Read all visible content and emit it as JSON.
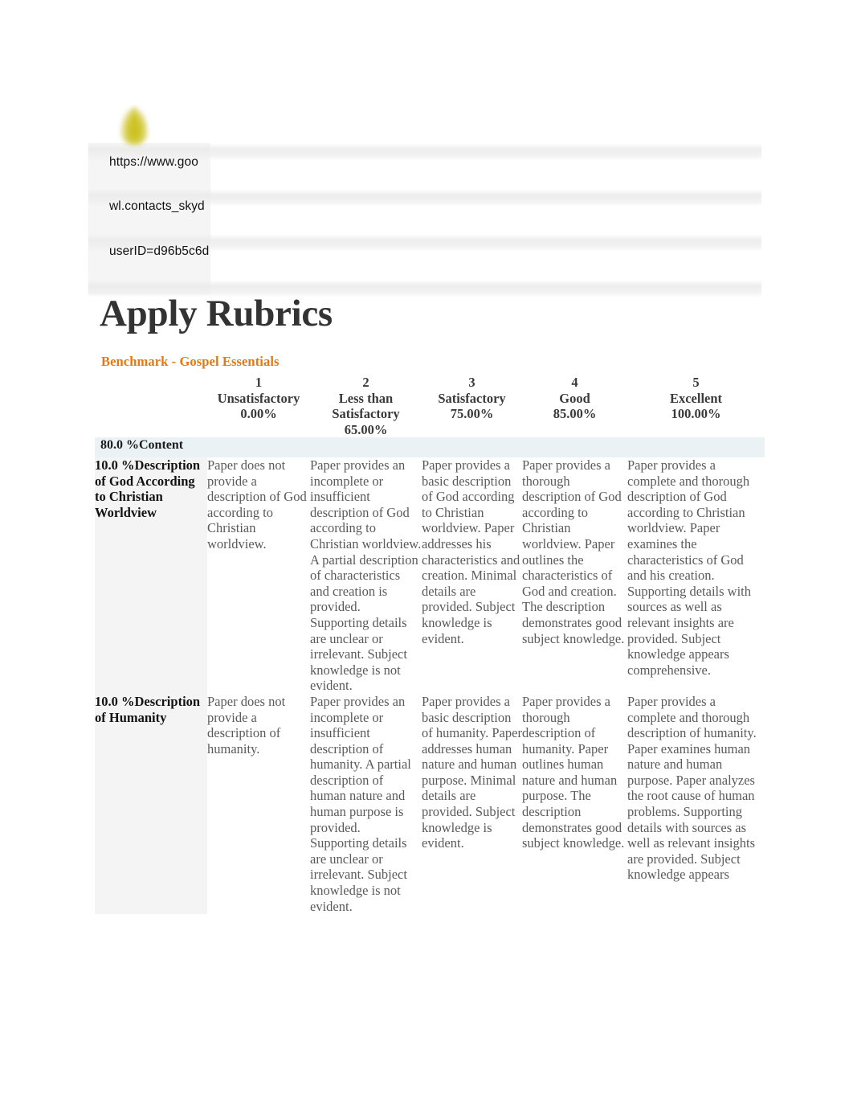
{
  "header": {
    "logo_icon": "flame-logo-icon",
    "lines": [
      "https://www.goo",
      "wl.contacts_skyd",
      "userID=d96b5c6d"
    ]
  },
  "document": {
    "title": "Apply Rubrics",
    "rubric_name": "Benchmark - Gospel Essentials",
    "accent_color": "#e8770c",
    "section_band_color": "#eaf2f5"
  },
  "table": {
    "corner_header": "",
    "columns": [
      {
        "number": "1",
        "label": "Unsatisfactory",
        "percent": "0.00%"
      },
      {
        "number": "2",
        "label": "Less than Satisfactory",
        "percent": "65.00%"
      },
      {
        "number": "3",
        "label": "Satisfactory",
        "percent": "75.00%"
      },
      {
        "number": "4",
        "label": "Good",
        "percent": "85.00%"
      },
      {
        "number": "5",
        "label": "Excellent",
        "percent": "100.00%"
      }
    ],
    "sections": [
      {
        "title": "80.0 %Content",
        "rows": [
          {
            "criterion": "10.0 %Description of God According to Christian Worldview",
            "cells": [
              "Paper does not provide a description of God according to Christian worldview.",
              "Paper provides an incomplete or insufficient description of God according to Christian worldview. A partial description of characteristics and creation is provided. Supporting details are unclear or irrelevant. Subject knowledge is not evident.",
              "Paper provides a basic description of God according to Christian worldview. Paper addresses his characteristics and creation. Minimal details are provided. Subject knowledge is evident.",
              "Paper provides a thorough description of God according to Christian worldview. Paper outlines the characteristics of God and creation. The description demonstrates good subject knowledge.",
              "Paper provides a complete and thorough description of God according to Christian worldview. Paper examines the characteristics of God and his creation. Supporting details with sources as well as relevant insights are provided. Subject knowledge appears comprehensive."
            ]
          },
          {
            "criterion": "10.0 %Description of Humanity",
            "cells": [
              "Paper does not provide a description of humanity.",
              "Paper provides an incomplete or insufficient description of humanity. A partial description of human nature and human purpose is provided. Supporting details are unclear or irrelevant. Subject knowledge is not evident.",
              "Paper provides a basic description of humanity. Paper addresses human nature and human purpose. Minimal details are provided. Subject knowledge is evident.",
              "Paper provides a thorough description of humanity. Paper outlines human nature and human purpose. The description demonstrates good subject knowledge.",
              "Paper provides a complete and thorough description of humanity. Paper examines human nature and human purpose. Paper analyzes the root cause of human problems. Supporting details with sources as well as relevant insights are provided. Subject knowledge appears"
            ]
          }
        ]
      }
    ]
  }
}
